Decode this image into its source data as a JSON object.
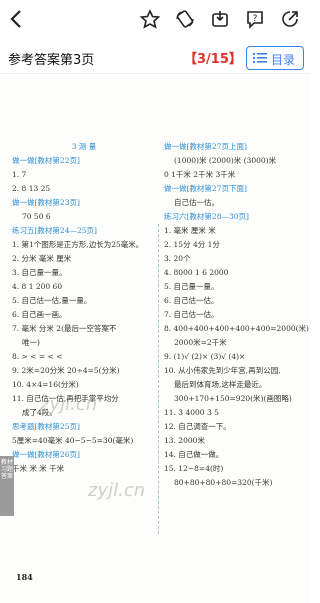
{
  "header": {
    "title": "参考答案第3页",
    "page_indicator": "【3/15】",
    "toc_label": "目录"
  },
  "left_column": [
    {
      "text": "3  测  量",
      "style": "cen"
    },
    {
      "text": "做一做[教材第22页]",
      "style": "sec"
    },
    {
      "text": "1. 7",
      "style": ""
    },
    {
      "text": "2. 8   13   25",
      "style": ""
    },
    {
      "text": "做一做[教材第23页]",
      "style": "sec"
    },
    {
      "text": "70   50   6",
      "style": "ind"
    },
    {
      "text": "练习五[教材第24—25页]",
      "style": "sec"
    },
    {
      "text": "1. 第1个图形是正方形,边长为25毫米。",
      "style": ""
    },
    {
      "text": "2. 分米   毫米   厘米",
      "style": ""
    },
    {
      "text": "3. 自己量一量。",
      "style": ""
    },
    {
      "text": "4. 8   1   200   60",
      "style": ""
    },
    {
      "text": "5. 自己估一估,量一量。",
      "style": ""
    },
    {
      "text": "6. 自己画一画。",
      "style": ""
    },
    {
      "text": "7. 毫米   分米   2(最后一空答案不",
      "style": ""
    },
    {
      "text": "唯一)",
      "style": "ind"
    },
    {
      "text": "8. >   <   =   <   <",
      "style": ""
    },
    {
      "text": "9. 2米=20分米   20÷4=5(分米)",
      "style": ""
    },
    {
      "text": "10. 4×4=16(分米)",
      "style": ""
    },
    {
      "text": "11. 自己估一估,再把手掌平均分",
      "style": ""
    },
    {
      "text": "成了4段。",
      "style": "ind"
    },
    {
      "text": "思考题[教材第25页]",
      "style": "sec"
    },
    {
      "text": "5厘米=40毫米   40−5−5=30(毫米)",
      "style": ""
    },
    {
      "text": "做一做[教材第26页]",
      "style": "sec"
    },
    {
      "text": "千米   米   米   千米",
      "style": ""
    }
  ],
  "right_column": [
    {
      "text": "做一做[教材第27页上面]",
      "style": "sec"
    },
    {
      "text": "(1000)米  (2000)米  (3000)米",
      "style": "ind"
    },
    {
      "text": "0        1千米    2千米    3千米",
      "style": ""
    },
    {
      "text": "做一做[教材第27页下面]",
      "style": "sec"
    },
    {
      "text": "自己估一估。",
      "style": "ind"
    },
    {
      "text": "练习六[教材第28—30页]",
      "style": "sec"
    },
    {
      "text": "1. 毫米   厘米   米",
      "style": ""
    },
    {
      "text": "2. 15分   4分   1分",
      "style": ""
    },
    {
      "text": "3. 20个",
      "style": ""
    },
    {
      "text": "4. 8000   1   6   2000",
      "style": ""
    },
    {
      "text": "5. 自己量一量。",
      "style": ""
    },
    {
      "text": "6. 自己估一估。",
      "style": ""
    },
    {
      "text": "7. 自己估一估。",
      "style": ""
    },
    {
      "text": "8. 400+400+400+400+400=2000(米)",
      "style": ""
    },
    {
      "text": "2000米=2千米",
      "style": "ind"
    },
    {
      "text": "9. (1)√  (2)×  (3)√  (4)×",
      "style": ""
    },
    {
      "text": "10. 从小伟家先到少年宫,再到公园,",
      "style": ""
    },
    {
      "text": "最后到体育场,这样走最近。",
      "style": "ind"
    },
    {
      "text": "300+170+150=920(米)(画图略)",
      "style": "ind"
    },
    {
      "text": "11. 3   4000   3   5",
      "style": ""
    },
    {
      "text": "12. 自己调查一下。",
      "style": ""
    },
    {
      "text": "13. 2000米",
      "style": ""
    },
    {
      "text": "14. 自己做一做。",
      "style": ""
    },
    {
      "text": "15. 12−8=4(时)",
      "style": ""
    },
    {
      "text": "80+80+80+80=320(千米)",
      "style": "ind"
    }
  ],
  "side_tab": "教材习题答案",
  "page_number": "184",
  "watermarks": [
    "zyjl.cn",
    "zyjl.cn"
  ]
}
